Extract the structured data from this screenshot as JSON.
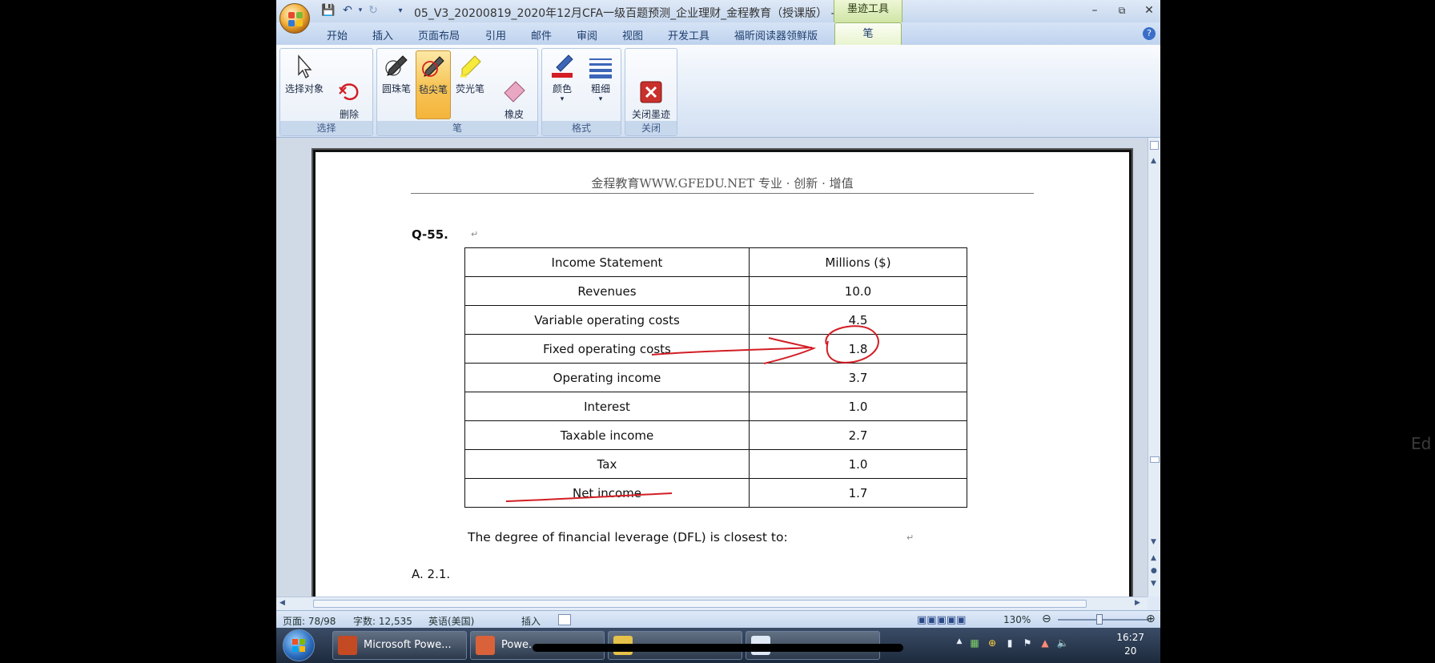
{
  "window": {
    "title": "05_V3_20200819_2020年12月CFA一级百题预测_企业理财_金程教育（授课版） - Mic...",
    "context_tab": "墨迹工具"
  },
  "tabs": [
    "开始",
    "插入",
    "页面布局",
    "引用",
    "邮件",
    "审阅",
    "视图",
    "开发工具",
    "福昕阅读器领鲜版",
    "笔"
  ],
  "ribbon": {
    "groups": {
      "select": "选择",
      "pen": "笔",
      "format": "格式",
      "close": "关闭"
    },
    "buttons": {
      "select_objects": "选择对象",
      "delete_all_ink": "删除\n所有墨迹",
      "ballpoint": "圆珠笔",
      "felt_tip": "毡尖笔",
      "highlighter": "荧光笔",
      "eraser": "橡皮\n擦",
      "color": "颜色",
      "thickness": "粗细",
      "close_ink": "关闭墨迹\n书写工具"
    }
  },
  "document": {
    "header": "金程教育WWW.GFEDU.NET    专业 · 创新 · 增值",
    "question_number": "Q-55.",
    "table": {
      "header": [
        "Income Statement",
        "Millions ($)"
      ],
      "rows": [
        [
          "Revenues",
          "10.0"
        ],
        [
          "Variable operating costs",
          "4.5"
        ],
        [
          "Fixed operating costs",
          "1.8"
        ],
        [
          "Operating income",
          "3.7"
        ],
        [
          "Interest",
          "1.0"
        ],
        [
          "Taxable income",
          "2.7"
        ],
        [
          "Tax",
          "1.0"
        ],
        [
          "Net income",
          "1.7"
        ]
      ]
    },
    "question": "The degree of financial leverage (DFL) is closest to:",
    "option_a": "A.    2.1."
  },
  "statusbar": {
    "page": "页面: 78/98",
    "words": "字数: 12,535",
    "language": "英语(美国)",
    "insert": "插入",
    "zoom": "130%"
  },
  "taskbar": {
    "items": [
      "Microsoft Powe...",
      "Powe..."
    ],
    "time": "16:27",
    "date": "20"
  },
  "edge_text": "Ed",
  "colors": {
    "ink_red": "#d21e24",
    "ribbon_active": "#f7c65a"
  }
}
